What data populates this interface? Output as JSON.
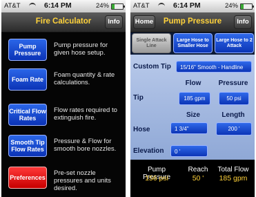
{
  "status": {
    "carrier": "AT&T",
    "time": "6:14 PM",
    "battery": "24%",
    "battery_level": 0.24
  },
  "left": {
    "title": "Fire Calculator",
    "info_label": "Info",
    "menu": [
      {
        "label": "Pump Pressure",
        "desc": "Pump pressure for given hose setup."
      },
      {
        "label": "Foam Rate",
        "desc": "Foam quantity & rate calculations."
      },
      {
        "label": "Critical Flow Rates",
        "desc": "Flow rates required to extinguish fire."
      },
      {
        "label": "Smooth Tip Flow Rates",
        "desc": "Pressure & Flow for smooth bore nozzles."
      },
      {
        "label": "Preferences",
        "desc": "Pre-set nozzle pressures and units desired."
      }
    ]
  },
  "right": {
    "home_label": "Home",
    "title": "Pump Pressure",
    "info_label": "Info",
    "tabs": [
      "Single Attack Line",
      "Large Hose to Smaller Hose",
      "Large Hose to 2 Attack"
    ],
    "custom_tip_label": "Custom Tip",
    "custom_tip_value": "15/16\" Smooth - Handline",
    "tip_label": "Tip",
    "flow_header": "Flow",
    "pressure_header": "Pressure",
    "flow_value": "185 gpm",
    "pressure_value": "50 psi",
    "hose_label": "Hose",
    "size_header": "Size",
    "length_header": "Length",
    "size_value": "1 3/4\"",
    "length_value": "200 '",
    "elevation_label": "Elevation",
    "elevation_value": "0 '",
    "footer": {
      "pump_pressure_label": "Pump Pressure",
      "pump_pressure_value": "156 psi",
      "reach_label": "Reach",
      "reach_value": "50 '",
      "total_flow_label": "Total Flow",
      "total_flow_value": "185 gpm"
    }
  }
}
